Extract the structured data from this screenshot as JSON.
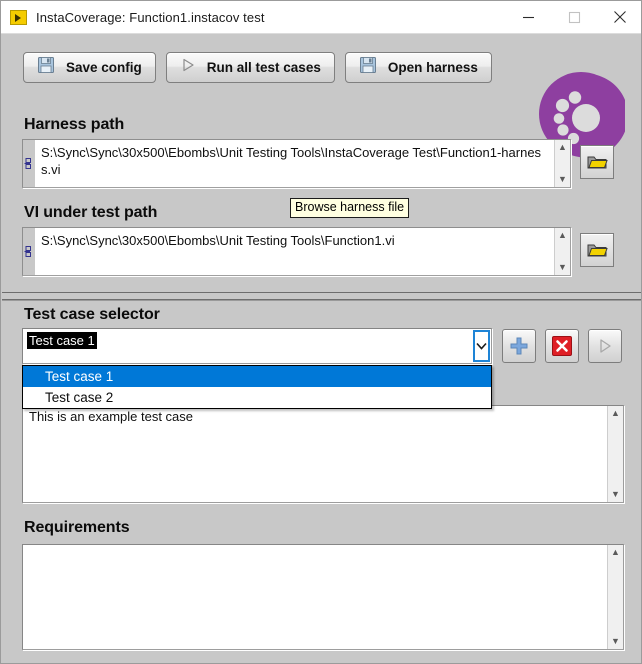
{
  "window": {
    "title": "InstaCoverage: Function1.instacov test",
    "app_icon": "labview-vi-icon",
    "minimize_label": "minimize-icon",
    "maximize_label": "maximize-icon",
    "close_label": "close-icon"
  },
  "toolbar": {
    "buttons": [
      {
        "label": "Save config",
        "icon": "save-disk-icon"
      },
      {
        "label": "Run all test cases",
        "icon": "play-triangle-icon"
      },
      {
        "label": "Open harness",
        "icon": "open-disk-icon"
      }
    ]
  },
  "logo": {
    "name": "instacoverage-logo",
    "color": "#8e3fa0"
  },
  "harness": {
    "heading": "Harness path",
    "value": "S:\\Sync\\Sync\\30x500\\Ebombs\\Unit Testing Tools\\InstaCoverage Test\\Function1-harness.vi",
    "browse_icon": "folder-icon",
    "tooltip": "Browse harness file"
  },
  "vi_under_test": {
    "heading": "VI under test path",
    "value": "S:\\Sync\\Sync\\30x500\\Ebombs\\Unit Testing Tools\\Function1.vi",
    "browse_icon": "folder-icon"
  },
  "test_case_selector": {
    "heading": "Test case selector",
    "selected": "Test case 1",
    "options": [
      "Test case 1",
      "Test case 2"
    ],
    "highlighted_index": 0,
    "buttons": [
      {
        "name": "add-test-case-button",
        "icon": "plus-icon"
      },
      {
        "name": "delete-test-case-button",
        "icon": "red-x-icon"
      },
      {
        "name": "run-test-case-button",
        "icon": "play-triangle-icon",
        "disabled": true
      }
    ]
  },
  "description": {
    "value": "This is an example test case"
  },
  "requirements": {
    "heading": "Requirements",
    "value": ""
  },
  "colors": {
    "accent_purple": "#8e3fa0",
    "selection_blue": "#0078d7",
    "panel_gray": "#c8c8c8",
    "tooltip_yellow": "#ffffe1"
  }
}
